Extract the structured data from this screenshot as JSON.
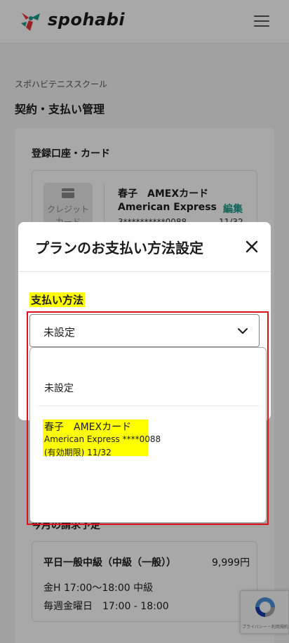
{
  "header": {
    "logo_text": "spohabi",
    "menu_icon": "hamburger-menu-icon"
  },
  "page": {
    "school_name": "スポハビテニススクール",
    "title": "契約・支払い管理",
    "registered_section_title": "登録口座・カード",
    "billing_section_title": "今月の請求予定"
  },
  "registered_card": {
    "thumb_label": "クレジット\nカード",
    "name": "春子　AMEXカード",
    "brand": "American Express",
    "number": "3**********0088",
    "expiry": "11/32",
    "edit_label": "編集"
  },
  "plan": {
    "name": "平日一般中級（中級（一般））",
    "price": "9,999円",
    "line1": "金H 17:00〜18:00 中級",
    "line2": "毎週金曜日　17:00 - 18:00"
  },
  "recaptcha": {
    "text": "プライバシー・利用規約"
  },
  "modal": {
    "title": "プランのお支払い方法設定",
    "close_icon": "close-icon",
    "field_label": "支払い方法",
    "selected_value": "未設定",
    "options": {
      "none": "未設定",
      "card_name": "春子　AMEXカード",
      "card_brand": "American Express ****0088",
      "card_expiry": "(有効期限) 11/32"
    }
  },
  "colors": {
    "accent": "#1a9a8a",
    "highlight": "#ffff00",
    "annotation_outline": "#e0101a",
    "logo_red": "#e8383d",
    "logo_teal": "#1a9a8a"
  }
}
